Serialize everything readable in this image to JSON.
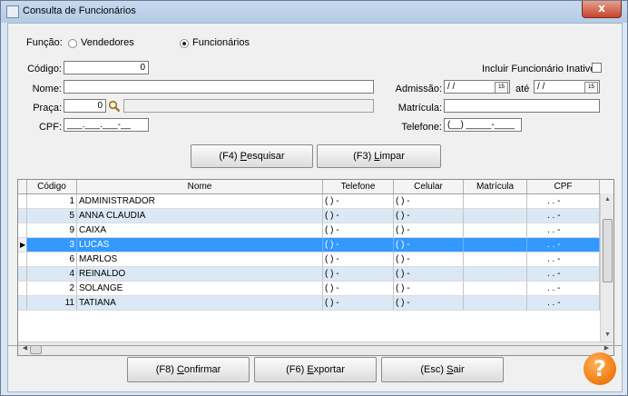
{
  "window": {
    "title": "Consulta de Funcionários",
    "close_label": "x"
  },
  "funcao": {
    "label": "Função:",
    "opt_vendedores": "Vendedores",
    "opt_funcionarios": "Funcionários",
    "selected": "Funcionários"
  },
  "form": {
    "codigo_label": "Código:",
    "codigo_value": "0",
    "nome_label": "Nome:",
    "nome_value": "",
    "praca_label": "Praça:",
    "praca_value": "0",
    "praca_desc": "",
    "cpf_label": "CPF:",
    "cpf_value": "___.___.___-__",
    "inativo_label": "Incluir Funcionário Inativo:",
    "admissao_label": "Admissão:",
    "admissao_from": "/ /",
    "ate_label": "até",
    "admissao_to": "/ /",
    "matricula_label": "Matrícula:",
    "matricula_value": "",
    "telefone_label": "Telefone:",
    "telefone_value": "(__) _____-____",
    "calendar_day": "15"
  },
  "buttons": {
    "pesquisar_pre": "(F4) ",
    "pesquisar_key": "P",
    "pesquisar_post": "esquisar",
    "limpar_pre": "(F3) ",
    "limpar_key": "L",
    "limpar_post": "impar",
    "confirmar_pre": "(F8) ",
    "confirmar_key": "C",
    "confirmar_post": "onfirmar",
    "exportar_pre": "(F6) ",
    "exportar_key": "E",
    "exportar_post": "xportar",
    "sair_pre": "(Esc) ",
    "sair_key": "S",
    "sair_post": "air",
    "help": "?"
  },
  "grid": {
    "columns": [
      "Código",
      "Nome",
      "Telefone",
      "Celular",
      "Matrícula",
      "CPF"
    ],
    "rows": [
      {
        "codigo": "1",
        "nome": "ADMINISTRADOR",
        "telefone": "( )   -",
        "celular": "( )   -",
        "matricula": "",
        "cpf": ". . -"
      },
      {
        "codigo": "5",
        "nome": "ANNA CLAUDIA",
        "telefone": "( )   -",
        "celular": "( )   -",
        "matricula": "",
        "cpf": ". . -"
      },
      {
        "codigo": "9",
        "nome": "CAIXA",
        "telefone": "( )   -",
        "celular": "( )   -",
        "matricula": "",
        "cpf": ". . -"
      },
      {
        "codigo": "3",
        "nome": "LUCAS",
        "telefone": "( )   -",
        "celular": "( )   -",
        "matricula": "",
        "cpf": ". . -"
      },
      {
        "codigo": "6",
        "nome": "MARLOS",
        "telefone": "( )   -",
        "celular": "( )   -",
        "matricula": "",
        "cpf": ". . -"
      },
      {
        "codigo": "4",
        "nome": "REINALDO",
        "telefone": "( )   -",
        "celular": "( )   -",
        "matricula": "",
        "cpf": ". . -"
      },
      {
        "codigo": "2",
        "nome": "SOLANGE",
        "telefone": "( )   -",
        "celular": "( )   -",
        "matricula": "",
        "cpf": ". . -"
      },
      {
        "codigo": "11",
        "nome": "TATIANA",
        "telefone": "( )   -",
        "celular": "( )   -",
        "matricula": "",
        "cpf": ". . -"
      }
    ],
    "selected_row_label": "LUCAS"
  },
  "colors": {
    "selection": "#3399ff",
    "alt_row": "#dbe8f5",
    "help": "#f07a10"
  }
}
